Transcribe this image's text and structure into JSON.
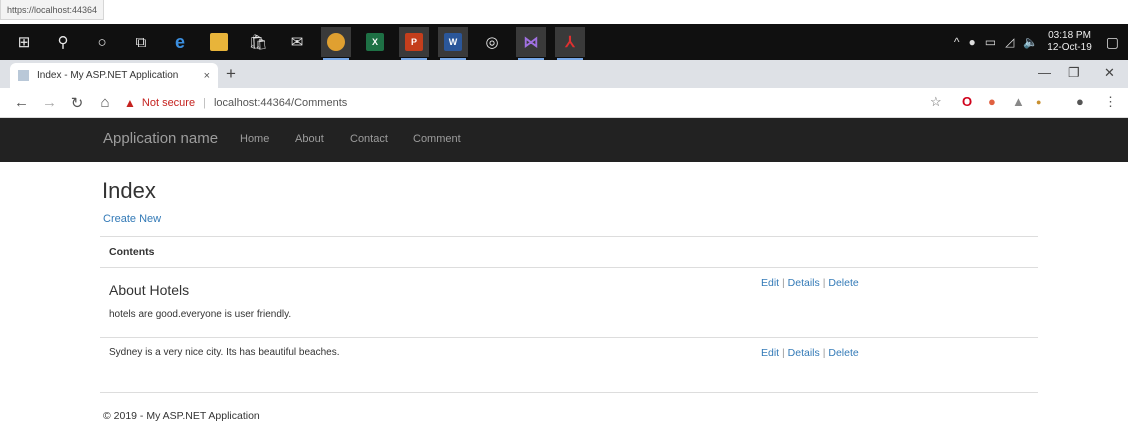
{
  "status_url": "https://localhost:44364",
  "taskbar": {
    "icons": [
      "windows-start-icon",
      "search-icon",
      "cortana-icon",
      "task-view-icon",
      "edge-icon",
      "file-explorer-icon",
      "store-icon",
      "mail-icon",
      "chrome-icon",
      "excel-icon",
      "powerpoint-icon",
      "word-icon",
      "obs-icon",
      "visual-studio-icon",
      "acrobat-icon"
    ],
    "time": "03:18 PM",
    "date": "12-Oct-19"
  },
  "browser": {
    "tab_title": "Index - My ASP.NET Application",
    "tab_close": "×",
    "new_tab": "+",
    "not_secure": "Not secure",
    "url": "localhost:44364/Comments"
  },
  "app": {
    "brand": "Application name",
    "nav": [
      "Home",
      "About",
      "Contact",
      "Comment"
    ]
  },
  "page": {
    "title": "Index",
    "create_new": "Create New",
    "column_header": "Contents",
    "rows": [
      {
        "title": "About Hotels",
        "text": "hotels are good.everyone is user friendly."
      },
      {
        "title": "",
        "text": "Sydney is a very nice city. Its has beautiful beaches."
      }
    ],
    "actions": {
      "edit": "Edit",
      "details": "Details",
      "delete": "Delete",
      "separator": "|"
    },
    "footer": "© 2019 - My ASP.NET Application"
  },
  "colors": {
    "navbar": "#222222",
    "link": "#337ab7",
    "not_secure": "#c5221f"
  }
}
